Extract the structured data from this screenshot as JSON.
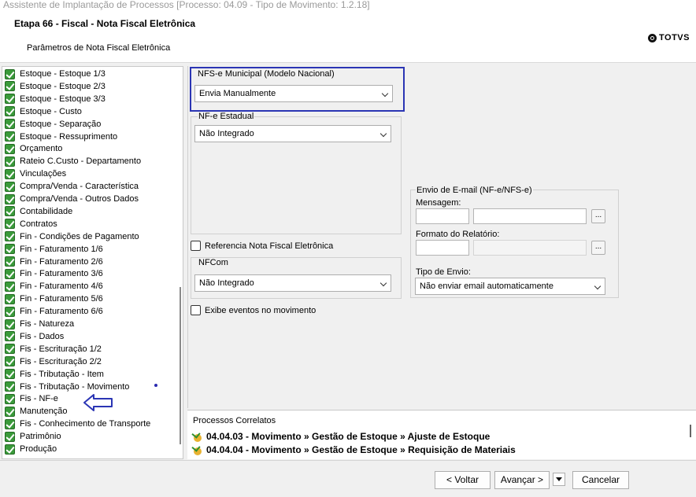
{
  "window": {
    "title": "Assistente de Implantação de Processos [Processo: 04.09 - Tipo de Movimento: 1.2.18]"
  },
  "header": {
    "step_title": "Etapa 66 - Fiscal - Nota Fiscal Eletrônica",
    "subtitle": "Parâmetros de Nota Fiscal Eletrônica",
    "logo_text": "TOTVS"
  },
  "tree": {
    "items": [
      {
        "label": "Estoque - Estoque 1/3"
      },
      {
        "label": "Estoque - Estoque 2/3"
      },
      {
        "label": "Estoque - Estoque 3/3"
      },
      {
        "label": "Estoque - Custo"
      },
      {
        "label": "Estoque - Separação"
      },
      {
        "label": "Estoque - Ressuprimento"
      },
      {
        "label": "Orçamento"
      },
      {
        "label": "Rateio C.Custo - Departamento"
      },
      {
        "label": "Vinculações"
      },
      {
        "label": "Compra/Venda - Característica"
      },
      {
        "label": "Compra/Venda - Outros Dados"
      },
      {
        "label": "Contabilidade"
      },
      {
        "label": "Contratos"
      },
      {
        "label": "Fin - Condições de Pagamento"
      },
      {
        "label": "Fin - Faturamento 1/6"
      },
      {
        "label": "Fin - Faturamento 2/6"
      },
      {
        "label": "Fin - Faturamento 3/6"
      },
      {
        "label": "Fin - Faturamento 4/6"
      },
      {
        "label": "Fin - Faturamento 5/6"
      },
      {
        "label": "Fin - Faturamento 6/6"
      },
      {
        "label": "Fis - Natureza"
      },
      {
        "label": "Fis - Dados"
      },
      {
        "label": "Fis - Escrituração 1/2"
      },
      {
        "label": "Fis - Escrituração 2/2"
      },
      {
        "label": "Fis - Tributação - Item"
      },
      {
        "label": "Fis - Tributação - Movimento"
      },
      {
        "label": "Fis - NF-e"
      },
      {
        "label": "Manutenção"
      },
      {
        "label": "Fis - Conhecimento de Transporte"
      },
      {
        "label": "Patrimônio"
      },
      {
        "label": "Produção"
      }
    ]
  },
  "form": {
    "nfse_municipal": {
      "label": "NFS-e Municipal (Modelo Nacional)",
      "value": "Envia Manualmente"
    },
    "nfe_estadual": {
      "label": "NF-e Estadual",
      "value": "Não Integrado"
    },
    "referencia_nfe": {
      "label": "Referencia Nota Fiscal Eletrônica",
      "checked": false
    },
    "nfcom": {
      "label": "NFCom",
      "value": "Não Integrado"
    },
    "exibe_eventos": {
      "label": "Exibe eventos no movimento",
      "checked": false
    },
    "email": {
      "group_label": "Envio de E-mail (NF-e/NFS-e)",
      "mensagem_label": "Mensagem:",
      "formato_label": "Formato do Relatório:",
      "tipo_label": "Tipo de Envio:",
      "tipo_value": "Não enviar email automaticamente",
      "ellipsis": "..."
    }
  },
  "processes": {
    "title": "Processos Correlatos",
    "rows": [
      {
        "text": "04.04.03 - Movimento » Gestão de Estoque » Ajuste de Estoque"
      },
      {
        "text": "04.04.04 - Movimento » Gestão de Estoque » Requisição de Materiais"
      }
    ]
  },
  "footer": {
    "back": "< Voltar",
    "next": "Avançar >",
    "cancel": "Cancelar"
  },
  "colors": {
    "highlight": "#2b35b4",
    "check_green": "#3a9a3a"
  }
}
